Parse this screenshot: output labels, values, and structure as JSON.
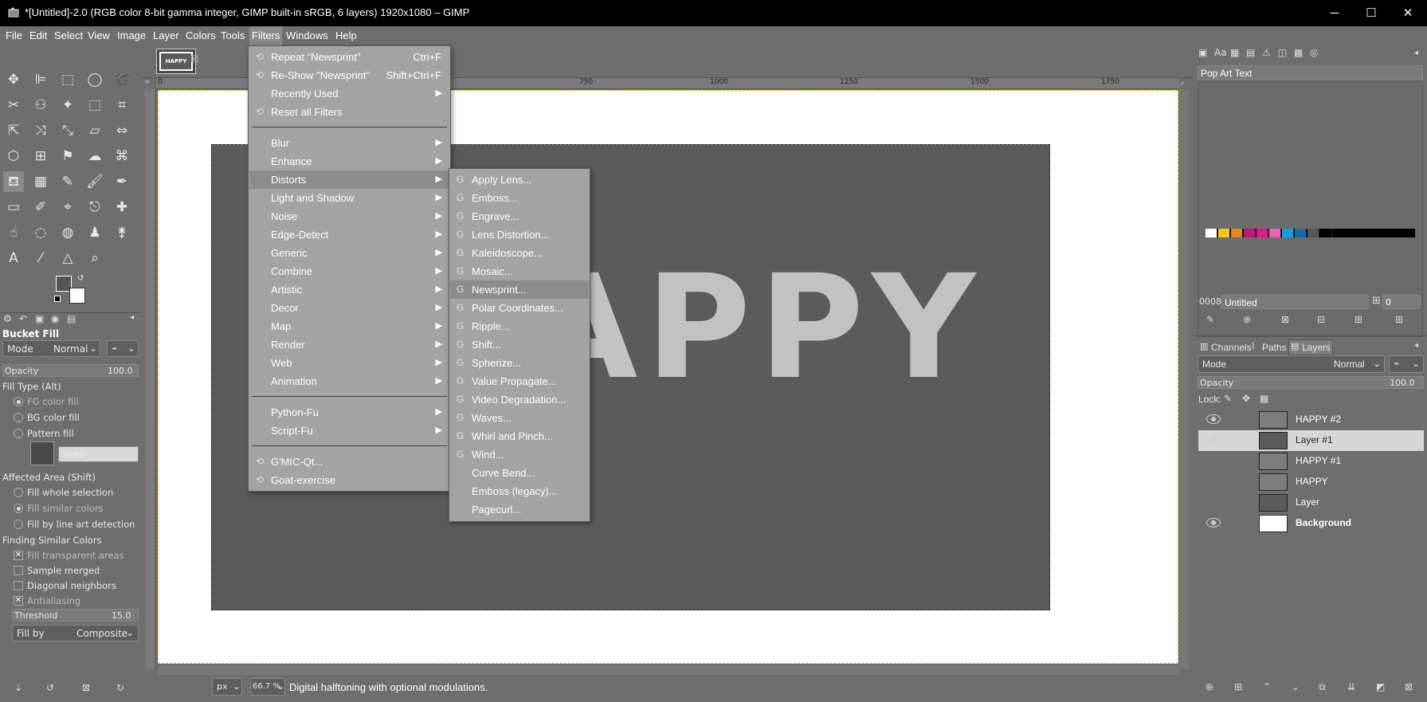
{
  "window": {
    "title": "*[Untitled]-2.0 (RGB color 8-bit gamma integer, GIMP built-in sRGB, 6 layers) 1920x1080 – GIMP",
    "minimize": "─",
    "maximize": "☐",
    "close": "✕"
  },
  "menubar": [
    "File",
    "Edit",
    "Select",
    "View",
    "Image",
    "Layer",
    "Colors",
    "Tools",
    "Filters",
    "Windows",
    "Help"
  ],
  "filters_menu": {
    "top": [
      {
        "label": "Repeat \"Newsprint\"",
        "shortcut": "Ctrl+F"
      },
      {
        "label": "Re-Show \"Newsprint\"",
        "shortcut": "Shift+Ctrl+F"
      },
      {
        "label": "Recently Used"
      },
      {
        "label": "Reset all Filters"
      }
    ],
    "groups": [
      "Blur",
      "Enhance",
      "Distorts",
      "Light and Shadow",
      "Noise",
      "Edge-Detect",
      "Generic",
      "Combine",
      "Artistic",
      "Decor",
      "Map",
      "Render",
      "Web",
      "Animation"
    ],
    "scripts": [
      "Python-Fu",
      "Script-Fu"
    ],
    "plugins": [
      "G'MIC-Qt...",
      "Goat-exercise"
    ]
  },
  "distorts_menu": [
    "Apply Lens...",
    "Emboss...",
    "Engrave...",
    "Lens Distortion...",
    "Kaleidoscope...",
    "Mosaic...",
    "Newsprint...",
    "Polar Coordinates...",
    "Ripple...",
    "Shift...",
    "Spherize...",
    "Value Propagate...",
    "Video Degradation...",
    "Waves...",
    "Whirl and Pinch...",
    "Wind...",
    "Curve Bend...",
    "Emboss (legacy)...",
    "Pagecurl..."
  ],
  "image_tab": {
    "thumb_text": "HAPPY"
  },
  "canvas": {
    "text": "APPY",
    "colors": {
      "canvas_bg": "#ffffff",
      "layer_bg": "#5b5b5b",
      "text": "#c2c2c2"
    }
  },
  "ruler": {
    "marks": [
      "0",
      "750",
      "1000",
      "1250",
      "1500",
      "1750"
    ]
  },
  "statusbar": {
    "unit": "px",
    "zoom": "66.7 %",
    "message": "Digital halftoning with optional modulations."
  },
  "tool_options": {
    "title": "Bucket Fill",
    "mode_label": "Mode",
    "mode_value": "Normal",
    "opacity_label": "Opacity",
    "opacity_value": "100.0",
    "fill_type_label": "Fill Type  (Alt)",
    "fill_types": [
      "FG color fill",
      "BG color fill",
      "Pattern fill"
    ],
    "pattern_name": "Slate",
    "affected_label": "Affected Area  (Shift)",
    "affected": [
      "Fill whole selection",
      "Fill similar colors",
      "Fill by line art detection"
    ],
    "finding_label": "Finding Similar Colors",
    "finding": [
      "Fill transparent areas",
      "Sample merged",
      "Diagonal neighbors",
      "Antialiasing"
    ],
    "threshold_label": "Threshold",
    "threshold_value": "15.0",
    "fillby_label": "Fill by",
    "fillby_value": "Composite"
  },
  "fonts_panel": {
    "name": "Pop Art Text"
  },
  "palette": {
    "colors": [
      "#ffffff",
      "#f5c518",
      "#e08a1e",
      "#c0187a",
      "#e0188c",
      "#f060b0",
      "#1a9ae0",
      "#1a6ab0",
      "#555555",
      "#000000"
    ],
    "index": "0008",
    "name": "Untitled",
    "columns": "0"
  },
  "layers_panel": {
    "tabs": [
      "Channels",
      "Paths",
      "Layers"
    ],
    "mode_label": "Mode",
    "mode_value": "Normal",
    "opacity_label": "Opacity",
    "opacity_value": "100.0",
    "lock_label": "Lock:",
    "layers": [
      "HAPPY #2",
      "Layer #1",
      "HAPPY #1",
      "HAPPY",
      "Layer",
      "Background"
    ]
  }
}
